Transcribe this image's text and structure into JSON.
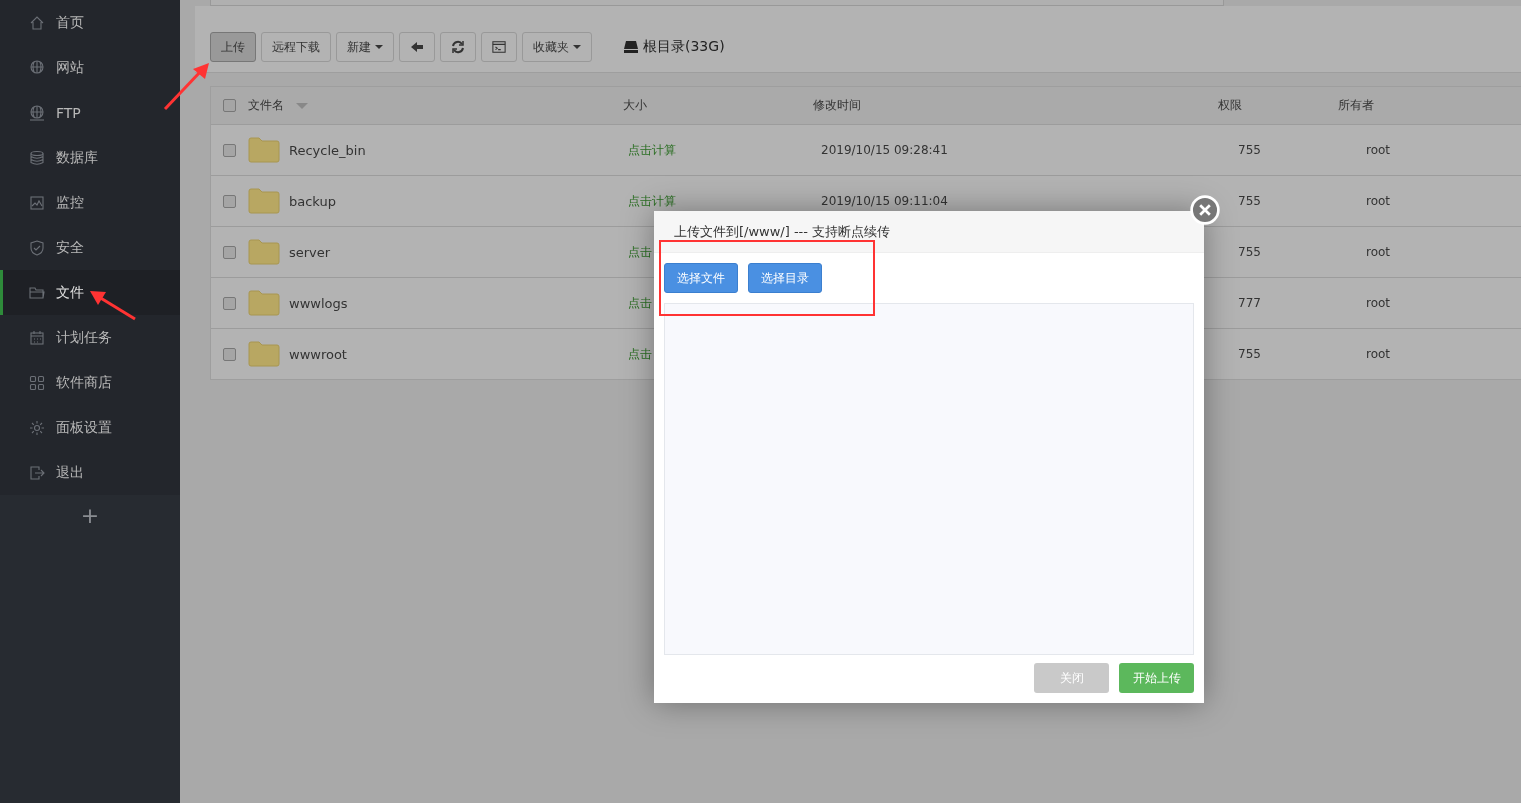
{
  "sidebar": {
    "items": [
      {
        "label": "首页",
        "kind": "home",
        "selected": false
      },
      {
        "label": "网站",
        "kind": "globe",
        "selected": false
      },
      {
        "label": "FTP",
        "kind": "ftp",
        "selected": false
      },
      {
        "label": "数据库",
        "kind": "database",
        "selected": false
      },
      {
        "label": "监控",
        "kind": "monitor",
        "selected": false
      },
      {
        "label": "安全",
        "kind": "shield",
        "selected": false
      },
      {
        "label": "文件",
        "kind": "folder",
        "selected": true
      },
      {
        "label": "计划任务",
        "kind": "calendar",
        "selected": false
      },
      {
        "label": "软件商店",
        "kind": "grid",
        "selected": false
      },
      {
        "label": "面板设置",
        "kind": "gear",
        "selected": false
      },
      {
        "label": "退出",
        "kind": "exit",
        "selected": false
      }
    ],
    "add_button": "+"
  },
  "toolbar": {
    "buttons": [
      {
        "kind": "text",
        "label": "上传",
        "pressed": true
      },
      {
        "kind": "text",
        "label": "远程下载",
        "pressed": false
      },
      {
        "kind": "dropdown",
        "label": "新建",
        "pressed": false
      },
      {
        "kind": "back",
        "pressed": false
      },
      {
        "kind": "refresh",
        "pressed": false
      },
      {
        "kind": "terminal",
        "pressed": false
      },
      {
        "kind": "dropdown",
        "label": "收藏夹",
        "pressed": false
      }
    ],
    "disk": "根目录(33G)"
  },
  "table": {
    "all_checked": false,
    "columns": [
      "文件名",
      "大小",
      "修改时间",
      "权限",
      "所有者"
    ],
    "rows": [
      {
        "checked": false,
        "name": "Recycle_bin",
        "size": "点击计算",
        "modified": "2019/10/15 09:28:41",
        "permission": "755",
        "owner": "root"
      },
      {
        "checked": false,
        "name": "backup",
        "size": "点击计算",
        "modified": "2019/10/15 09:11:04",
        "permission": "755",
        "owner": "root"
      },
      {
        "checked": false,
        "name": "server",
        "size": "点击",
        "permission": "755",
        "owner": "root"
      },
      {
        "checked": false,
        "name": "wwwlogs",
        "size": "点击",
        "permission": "777",
        "owner": "root"
      },
      {
        "checked": false,
        "name": "wwwroot",
        "size": "点击",
        "permission": "755",
        "owner": "root"
      }
    ]
  },
  "dialog": {
    "title": "上传文件到[/www/] --- 支持断点续传",
    "pick_buttons": [
      "选择文件",
      "选择目录"
    ],
    "footer_buttons": [
      {
        "label": "关闭",
        "disabled": true
      },
      {
        "label": "开始上传",
        "disabled": false
      }
    ]
  }
}
